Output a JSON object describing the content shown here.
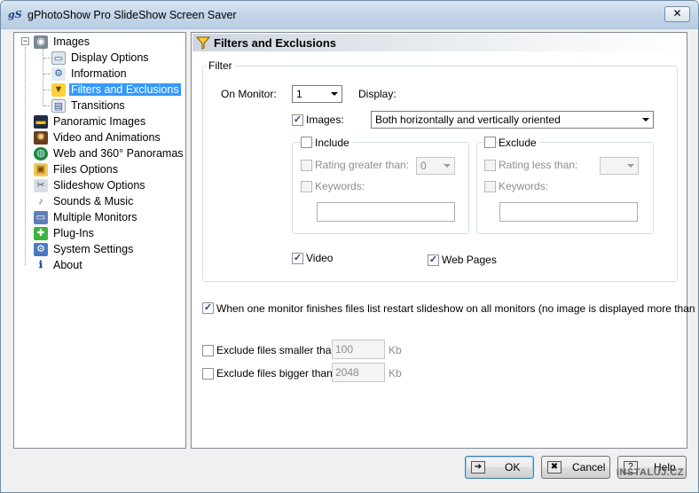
{
  "window": {
    "title": "gPhotoShow Pro SlideShow Screen Saver",
    "close_glyph": "✕"
  },
  "tree": {
    "items": [
      {
        "label": "Images",
        "icon": "camera-icon"
      },
      {
        "label": "Display Options",
        "icon": "monitor-icon"
      },
      {
        "label": "Information",
        "icon": "info-gear-icon"
      },
      {
        "label": "Filters and Exclusions",
        "icon": "filter-funnel-icon"
      },
      {
        "label": "Transitions",
        "icon": "transitions-icon"
      },
      {
        "label": "Panoramic Images",
        "icon": "film-strip-icon"
      },
      {
        "label": "Video and Animations",
        "icon": "film-reel-icon"
      },
      {
        "label": "Web and 360° Panoramas",
        "icon": "globe-icon"
      },
      {
        "label": "Files Options",
        "icon": "folder-icon"
      },
      {
        "label": "Slideshow Options",
        "icon": "tools-icon"
      },
      {
        "label": "Sounds & Music",
        "icon": "music-note-icon"
      },
      {
        "label": "Multiple Monitors",
        "icon": "monitors-icon"
      },
      {
        "label": "Plug-Ins",
        "icon": "puzzle-icon"
      },
      {
        "label": "System Settings",
        "icon": "settings-icon"
      },
      {
        "label": "About",
        "icon": "about-icon"
      }
    ],
    "selected": "Filters and Exclusions"
  },
  "panel": {
    "title": "Filters and Exclusions",
    "filter_group": "Filter",
    "on_monitor_label": "On Monitor:",
    "on_monitor_value": "1",
    "display_label": "Display:",
    "images_label": "Images:",
    "images_checked": true,
    "images_orientation": "Both horizontally and vertically oriented",
    "include": {
      "label": "Include",
      "rating_label": "Rating greater than:",
      "rating_value": "0",
      "keywords_label": "Keywords:",
      "keywords_value": ""
    },
    "exclude": {
      "label": "Exclude",
      "rating_label": "Rating less than:",
      "rating_value": "",
      "keywords_label": "Keywords:",
      "keywords_value": ""
    },
    "video_label": "Video",
    "video_checked": true,
    "web_pages_label": "Web Pages",
    "web_pages_checked": true,
    "restart_label": "When one monitor finishes files list restart slideshow on all monitors (no image is displayed more than once)",
    "restart_checked": true,
    "exclude_smaller_label": "Exclude files smaller than",
    "exclude_smaller_value": "100",
    "exclude_smaller_unit": "Kb",
    "exclude_bigger_label": "Exclude files bigger than",
    "exclude_bigger_value": "2048",
    "exclude_bigger_unit": "Kb"
  },
  "buttons": {
    "ok": "OK",
    "cancel": "Cancel",
    "help": "Help"
  },
  "watermark": "INSTALUJ.CZ",
  "check_glyph": "✓"
}
